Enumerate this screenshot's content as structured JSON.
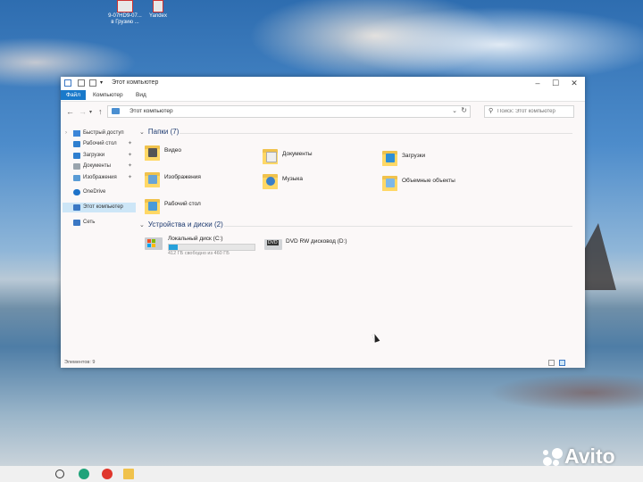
{
  "desktop_icons": [
    {
      "name": "html-file-icon",
      "label_line1": "9-07HD9-07...",
      "label_line2": "в Грузию ..."
    },
    {
      "name": "yandex-icon",
      "label_line1": "Yandex",
      "label_line2": ""
    }
  ],
  "window": {
    "title": "Этот компьютер",
    "ribbon_tabs": [
      "Файл",
      "Компьютер",
      "Вид"
    ],
    "address": "Этот компьютер",
    "search_placeholder": "Поиск: Этот компьютер"
  },
  "sidebar": {
    "items": [
      {
        "label": "Быстрый доступ",
        "icon": "star-icon",
        "pinned": false,
        "selected": false
      },
      {
        "label": "Рабочий стол",
        "icon": "desktop-folder-icon",
        "pinned": true,
        "selected": false
      },
      {
        "label": "Загрузки",
        "icon": "downloads-icon",
        "pinned": true,
        "selected": false
      },
      {
        "label": "Документы",
        "icon": "documents-icon",
        "pinned": true,
        "selected": false
      },
      {
        "label": "Изображения",
        "icon": "pictures-icon",
        "pinned": true,
        "selected": false
      },
      {
        "label": "OneDrive",
        "icon": "cloud-icon",
        "pinned": false,
        "selected": false
      },
      {
        "label": "Этот компьютер",
        "icon": "computer-icon",
        "pinned": false,
        "selected": true
      },
      {
        "label": "Сеть",
        "icon": "network-icon",
        "pinned": false,
        "selected": false
      }
    ]
  },
  "folders_group": {
    "header": "Папки (7)",
    "items": [
      {
        "label": "Видео",
        "icon": "video-folder-icon"
      },
      {
        "label": "Документы",
        "icon": "documents-folder-icon"
      },
      {
        "label": "Загрузки",
        "icon": "downloads-folder-icon"
      },
      {
        "label": "Изображения",
        "icon": "pictures-folder-icon"
      },
      {
        "label": "Музыка",
        "icon": "music-folder-icon"
      },
      {
        "label": "Объемные объекты",
        "icon": "3d-objects-folder-icon"
      },
      {
        "label": "Рабочий стол",
        "icon": "desktop-folder-icon"
      }
    ]
  },
  "drives_group": {
    "header": "Устройства и диски (2)",
    "items": [
      {
        "label": "Локальный диск (C:)",
        "free": "412 ГБ свободно из 460 ГБ",
        "used_fraction": 0.104,
        "icon": "local-disk-icon"
      },
      {
        "label": "DVD RW дисковод (D:)",
        "icon": "dvd-drive-icon",
        "badge": "DVD"
      }
    ]
  },
  "status": "Элементов: 9",
  "watermark": "Avito",
  "colors": {
    "accent": "#1979ca",
    "selection": "#cde6f7",
    "folder": "#ffd866",
    "drive_bar": "#26a0da"
  }
}
